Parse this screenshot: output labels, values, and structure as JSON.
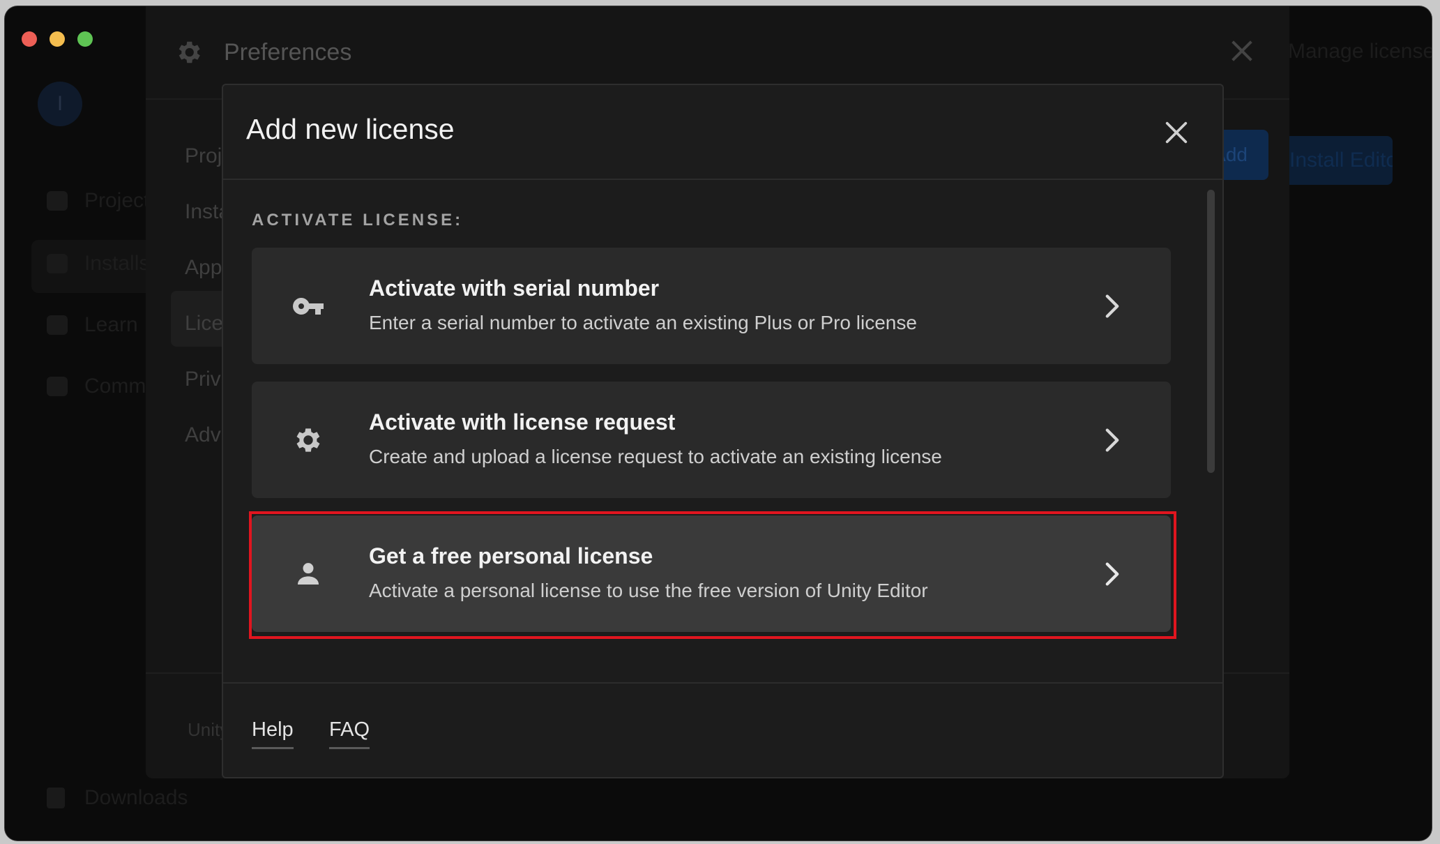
{
  "background": {
    "sidebar_items": [
      "Projects",
      "Installs",
      "Learn",
      "Community"
    ],
    "downloads_label": "Downloads",
    "top_right_text": "Manage licenses",
    "install_editor_label": "Install Editor",
    "preferences": {
      "title": "Preferences",
      "nav_items": [
        "Projects",
        "Installs",
        "Appearance",
        "Licenses",
        "Privacy",
        "Advanced"
      ],
      "add_button_label": "Add",
      "footer_text": "Unity"
    }
  },
  "modal": {
    "title": "Add new license",
    "section_label": "ACTIVATE LICENSE:",
    "options": [
      {
        "title": "Activate with serial number",
        "description": "Enter a serial number to activate an existing Plus or Pro license",
        "icon": "key-icon"
      },
      {
        "title": "Activate with license request",
        "description": "Create and upload a license request to activate an existing license",
        "icon": "gear-icon"
      },
      {
        "title": "Get a free personal license",
        "description": "Activate a personal license to use the free version of Unity Editor",
        "icon": "person-icon",
        "highlighted": true
      }
    ],
    "footer_links": [
      "Help",
      "FAQ"
    ]
  },
  "colors": {
    "highlight_border": "#e0151f",
    "modal_background": "#1c1c1c",
    "option_background": "#2a2a2a"
  }
}
